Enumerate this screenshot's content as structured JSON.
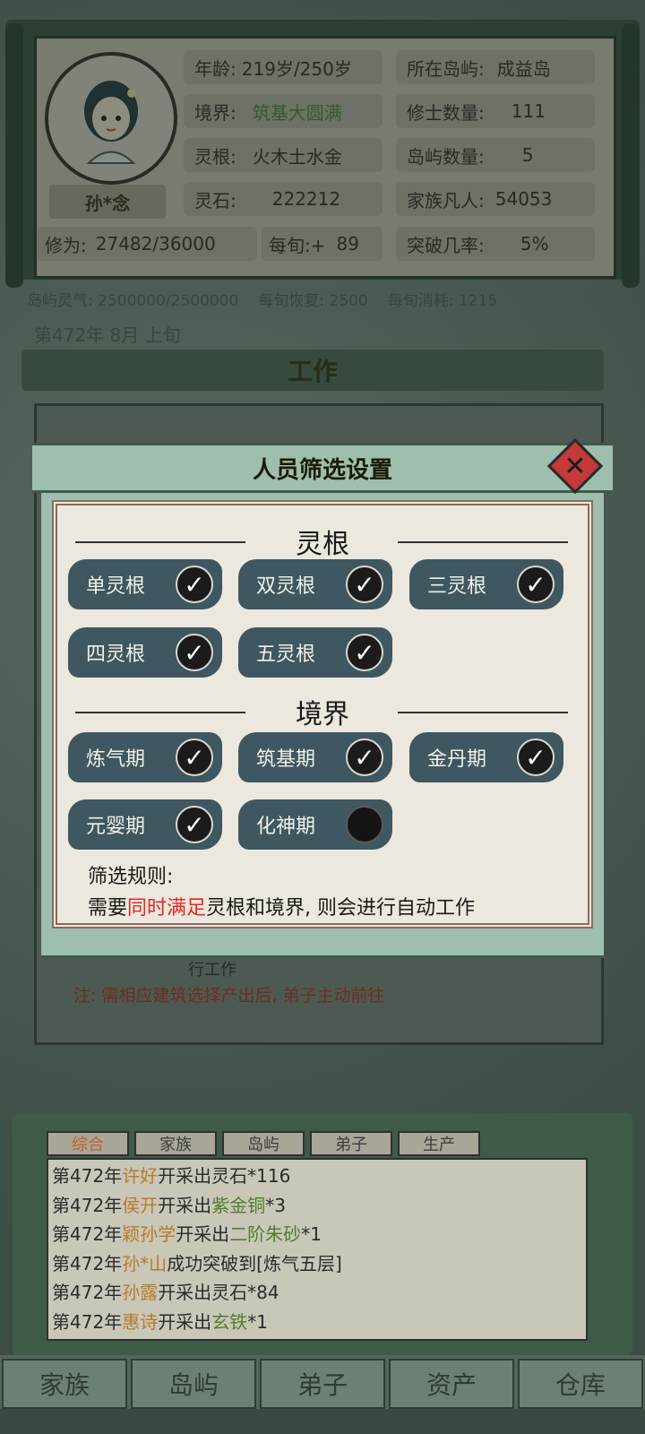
{
  "character": {
    "name": "孙*念",
    "age_label": "年龄:",
    "age_value": "219岁/250岁",
    "realm_label": "境界:",
    "realm_value": "筑基大圆满",
    "root_label": "灵根:",
    "root_value": "火木土水金",
    "stone_label": "灵石:",
    "stone_value": "222212",
    "cultivation_label": "修为:",
    "cultivation_value": "27482/36000",
    "per_period_label": "每旬:+",
    "per_period_value": "89",
    "island_label": "所在岛屿:",
    "island_value": "成益岛",
    "cultivators_label": "修士数量:",
    "cultivators_value": "111",
    "islands_label": "岛屿数量:",
    "islands_value": "5",
    "mortals_label": "家族凡人:",
    "mortals_value": "54053",
    "breakthrough_label": "突破几率:",
    "breakthrough_value": "5%"
  },
  "island_bar": {
    "qi": "岛屿灵气: 2500000/2500000",
    "recover": "每旬恢复: 2500",
    "consume": "每旬消耗: 1215"
  },
  "date": "第472年 8月 上旬",
  "work_panel": {
    "title": "工作",
    "note_tail": "行工作",
    "note": "注: 需相应建筑选择产出后, 弟子主动前往"
  },
  "dialog": {
    "title": "人员筛选设置",
    "roots_title": "灵根",
    "roots": [
      {
        "label": "单灵根",
        "checked": true
      },
      {
        "label": "双灵根",
        "checked": true
      },
      {
        "label": "三灵根",
        "checked": true
      },
      {
        "label": "四灵根",
        "checked": true
      },
      {
        "label": "五灵根",
        "checked": true
      }
    ],
    "realm_title": "境界",
    "realms": [
      {
        "label": "炼气期",
        "checked": true
      },
      {
        "label": "筑基期",
        "checked": true
      },
      {
        "label": "金丹期",
        "checked": true
      },
      {
        "label": "元婴期",
        "checked": true
      },
      {
        "label": "化神期",
        "checked": false
      }
    ],
    "rule_label": "筛选规则:",
    "rule_prefix": "需要",
    "rule_highlight": "同时满足",
    "rule_suffix": "灵根和境界, 则会进行自动工作",
    "checkmark": "✓"
  },
  "log": {
    "tabs": [
      "综合",
      "家族",
      "岛屿",
      "弟子",
      "生产"
    ],
    "active_tab": 0,
    "lines": [
      {
        "year": "第472年",
        "name": "许好",
        "action": "开采出灵石*116",
        "item": ""
      },
      {
        "year": "第472年",
        "name": "侯开",
        "action": "开采出",
        "item": "紫金铜",
        "tail": "*3"
      },
      {
        "year": "第472年",
        "name": "颖孙学",
        "action": "开采出",
        "item": "二阶朱砂",
        "tail": "*1"
      },
      {
        "year": "第472年",
        "name": "孙*山",
        "action": "成功突破到[炼气五层]",
        "item": ""
      },
      {
        "year": "第472年",
        "name": "孙露",
        "action": "开采出灵石*84",
        "item": ""
      },
      {
        "year": "第472年",
        "name": "惠诗",
        "action": "开采出",
        "item": "玄铁",
        "tail": "*1"
      }
    ]
  },
  "bottom_nav": [
    "家族",
    "岛屿",
    "弟子",
    "资产",
    "仓库"
  ],
  "colors": {
    "accent_red": "#e02828",
    "chip_bg": "#3e5760",
    "dialog_header": "#9ebfad"
  }
}
